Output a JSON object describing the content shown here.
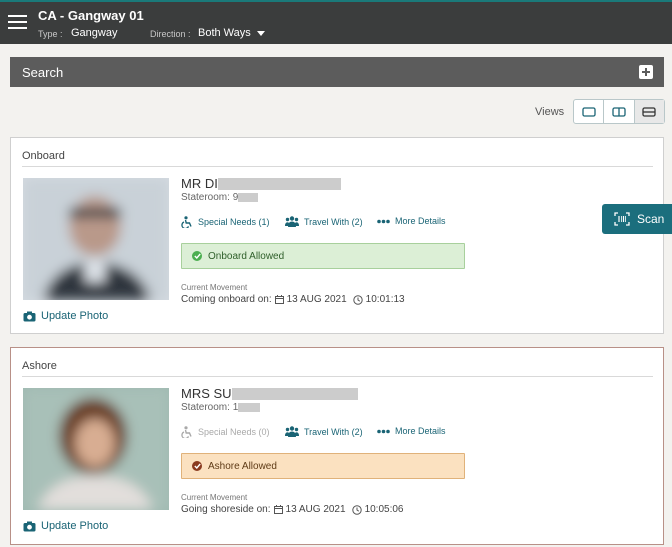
{
  "header": {
    "title": "CA - Gangway 01",
    "type_label": "Type :",
    "type_value": "Gangway",
    "direction_label": "Direction :",
    "direction_value": "Both Ways"
  },
  "search": {
    "label": "Search"
  },
  "views": {
    "label": "Views"
  },
  "scan": {
    "label": "Scan"
  },
  "cards": [
    {
      "section_title": "Onboard",
      "name": "MR DI",
      "stateroom": "Stateroom: 9",
      "special_needs": "Special Needs (1)",
      "special_needs_enabled": true,
      "travel_with": "Travel With (2)",
      "more_details": "More Details",
      "status": "Onboard Allowed",
      "status_color": "#4caf50",
      "current_movement_label": "Current Movement",
      "movement_prefix": "Coming onboard on:",
      "date": "13 AUG 2021",
      "time": "10:01:13",
      "update_photo": "Update Photo"
    },
    {
      "section_title": "Ashore",
      "name": "MRS SU",
      "stateroom": "Stateroom: 1",
      "special_needs": "Special Needs (0)",
      "special_needs_enabled": false,
      "travel_with": "Travel With (2)",
      "more_details": "More Details",
      "status": "Ashore Allowed",
      "status_color": "#8a3b1f",
      "current_movement_label": "Current Movement",
      "movement_prefix": "Going shoreside on:",
      "date": "13 AUG 2021",
      "time": "10:05:06",
      "update_photo": "Update Photo"
    }
  ]
}
